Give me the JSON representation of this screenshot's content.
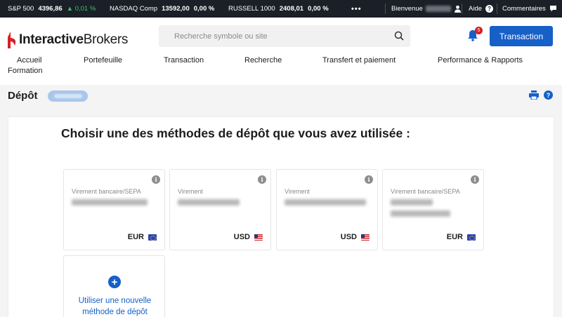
{
  "ticker": {
    "sp500": {
      "name": "S&P 500",
      "value": "4396,86",
      "change": "▲ 0,01 %"
    },
    "nasdaq": {
      "name": "NASDAQ Comp",
      "value": "13592,00",
      "change": "0,00 %"
    },
    "russell": {
      "name": "RUSSELL 1000",
      "value": "2408,01",
      "change": "0,00 %"
    },
    "more": "•••",
    "welcome": "Bienvenue",
    "help": "Aide",
    "comments": "Commentaires"
  },
  "header": {
    "logo_bold": "Interactive",
    "logo_light": "Brokers",
    "search_placeholder": "Recherche symbole ou site",
    "notification_count": "5",
    "trade_button": "Transaction"
  },
  "nav": {
    "items": [
      "Accueil",
      "Portefeuille",
      "Transaction",
      "Recherche",
      "Transfert et paiement",
      "Performance & Rapports",
      "Formation"
    ]
  },
  "page": {
    "title": "Dépôt",
    "heading": "Choisir une des méthodes de dépôt que vous avez utilisée :"
  },
  "methods": [
    {
      "type": "Virement bancaire/SEPA",
      "currency": "EUR",
      "flag": "eu"
    },
    {
      "type": "Virement",
      "currency": "USD",
      "flag": "us"
    },
    {
      "type": "Virement",
      "currency": "USD",
      "flag": "us"
    },
    {
      "type": "Virement bancaire/SEPA",
      "currency": "EUR",
      "flag": "eu"
    }
  ],
  "new_method": {
    "line1": "Utiliser une nouvelle",
    "line2": "méthode de dépôt"
  },
  "colors": {
    "accent": "#1660c8",
    "ticker_bg": "#1b1f27",
    "up": "#37c36b",
    "badge": "#d81f26"
  }
}
